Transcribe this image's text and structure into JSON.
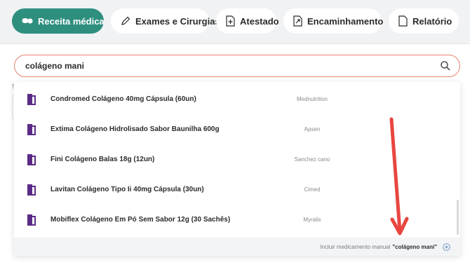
{
  "tabs": [
    {
      "label": "Receita médica",
      "icon": "pills-icon",
      "active": true
    },
    {
      "label": "Exames e Cirurgias",
      "icon": "pen-icon",
      "active": false
    },
    {
      "label": "Atestado",
      "icon": "document-plus-icon",
      "active": false
    },
    {
      "label": "Encaminhamento",
      "icon": "document-arrow-icon",
      "active": false
    },
    {
      "label": "Relatório",
      "icon": "document-icon",
      "active": false
    }
  ],
  "search": {
    "value": "colágeno mani",
    "icon": "search-icon"
  },
  "results": [
    {
      "name": "Condromed Colágeno 40mg Cápsula (60un)",
      "brand": "Mednutrition"
    },
    {
      "name": "Extima Colágeno Hidrolisado Sabor Baunilha 600g",
      "brand": "Apsen"
    },
    {
      "name": "Fini Colágeno Balas 18g (12un)",
      "brand": "Sanchez cano"
    },
    {
      "name": "Lavitan Colágeno Tipo Ii 40mg Cápsula (30un)",
      "brand": "Cimed"
    },
    {
      "name": "Mobiflex Colágeno Em Pó Sem Sabor 12g (30 Sachês)",
      "brand": "Myralis"
    }
  ],
  "footer": {
    "prefix": "Incluir medicamento manual",
    "query": "\"colágeno mani\"",
    "icon": "plus-circle-icon"
  },
  "ghost_label": "N",
  "colors": {
    "accent": "#2e8f7f",
    "search_border": "#e3826f",
    "pill": "#5b2a86",
    "annotation": "#e8463f"
  }
}
